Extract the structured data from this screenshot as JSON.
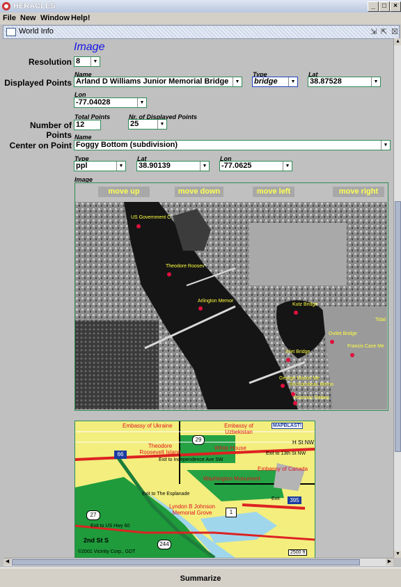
{
  "window": {
    "title": "HERACLES"
  },
  "menubar": [
    "File",
    "New",
    "Window",
    "Help!"
  ],
  "internal_frame": {
    "title": "World Info"
  },
  "section_heading": "Image",
  "resolution": {
    "label": "Resolution",
    "value": "8"
  },
  "displayed_points": {
    "label": "Displayed Points",
    "name_label": "Name",
    "name_value": "Arland D Williams Junior Memorial Bridge",
    "type_label": "Type",
    "type_value": "bridge",
    "lat_label": "Lat",
    "lat_value": "38.87528",
    "lon_label": "Lon",
    "lon_value": "-77.04028"
  },
  "number_of_points": {
    "label": "Number of Points",
    "total_label": "Total Points",
    "total_value": "12",
    "displayed_label": "Nr. of Displayed Points",
    "displayed_value": "25"
  },
  "center_on_point": {
    "label": "Center on Point",
    "name_label": "Name",
    "name_value": "Foggy Bottom (subdivision)",
    "type_label": "Type",
    "type_value": "ppl",
    "lat_label": "Lat",
    "lat_value": "38.90139",
    "lon_label": "Lon",
    "lon_value": "-77.0625"
  },
  "image_panel": {
    "label": "Image",
    "buttons": [
      "move up",
      "move down",
      "move left",
      "move right"
    ],
    "photo_labels": [
      "US Government C",
      "Theodore Roosev",
      "Arlington Memor",
      "Kutz Bridge",
      "Outlet Bridge",
      "Francis Case Me",
      "Inlet Bridge",
      "George Mason Me",
      "Rochambeau Memo",
      "Potomac Railwa",
      "Tidal"
    ]
  },
  "map_labels": [
    "Embassy of Ukraine",
    "Embassy of Uzbekistan",
    "MAPBLAST!",
    "H St NW",
    "66",
    "Theodore Roosevelt Island",
    "White House",
    "Exit to 13th St NW",
    "Exit to Independence Ave SW",
    "Embassy of Canada",
    "Washington Monument",
    "Exit to The Esplanade",
    "395",
    "27",
    "Lyndon B Johnson Memorial Grove",
    "Exit to US Hwy 60",
    "1",
    "2nd St S",
    "244",
    "©2001 Vicinity Corp., GDT",
    "2500 ft",
    "Exit",
    "29"
  ],
  "summarize_label": "Summarize",
  "colors": {
    "accent_green": "#2e8b57",
    "heading_blue": "#1414e6",
    "marker_red": "#e0103c",
    "photo_label_yellow": "#ffff40"
  }
}
